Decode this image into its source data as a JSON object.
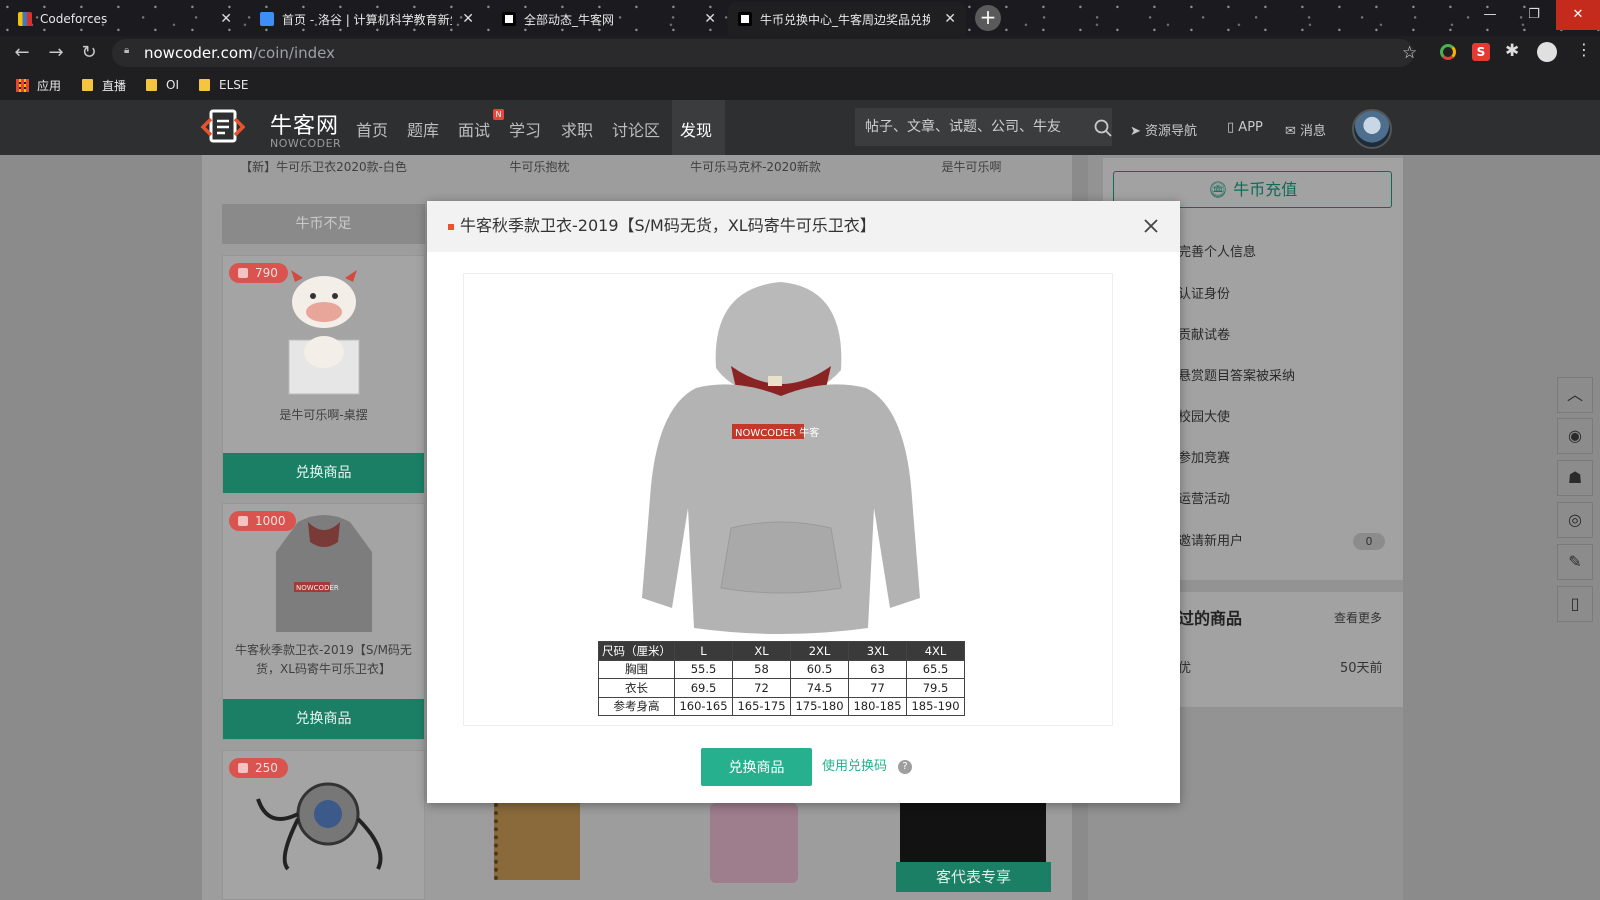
{
  "browser": {
    "tabs": [
      {
        "title": "Codeforces",
        "active": false
      },
      {
        "title": "首页 - 洛谷 | 计算机科学教育新生",
        "active": false
      },
      {
        "title": "全部动态_牛客网",
        "active": false
      },
      {
        "title": "牛币兑换中心_牛客周边奖品兑换",
        "active": true
      }
    ],
    "url_host": "nowcoder.com",
    "url_path": "/coin/index",
    "bookmarks": [
      {
        "label": "应用"
      },
      {
        "label": "直播"
      },
      {
        "label": "OI"
      },
      {
        "label": "ELSE"
      }
    ]
  },
  "site": {
    "logo_text": "牛客网",
    "logo_sub": "NOWCODER",
    "nav": [
      {
        "label": "首页"
      },
      {
        "label": "题库"
      },
      {
        "label": "面试"
      },
      {
        "label": "学习"
      },
      {
        "label": "求职"
      },
      {
        "label": "讨论区"
      },
      {
        "label": "发现"
      }
    ],
    "nav_active": "发现",
    "nav_badge": "N",
    "search_placeholder": "帖子、文章、试题、公司、牛友",
    "header_links": [
      {
        "label": "资源导航"
      },
      {
        "label": "APP"
      },
      {
        "label": "消息"
      }
    ]
  },
  "products": {
    "top_row_names": [
      "【新】牛可乐卫衣2020款-白色",
      "牛可乐抱枕",
      "牛可乐马克杯-2020新款",
      "是牛可乐啊"
    ],
    "insufficient_label": "牛币不足",
    "cards": [
      {
        "price": "790",
        "name": "是牛可乐啊-桌摆",
        "button": "兑换商品"
      },
      {
        "price": "1000",
        "name": "牛客秋季款卫衣-2019【S/M码无货，XL码寄牛可乐卫衣】",
        "button": "兑换商品"
      },
      {
        "price": "250",
        "name": "",
        "button": ""
      }
    ],
    "bottom_banner": "客代表专享"
  },
  "sidebar": {
    "recharge_label": "牛币充值",
    "tasks": [
      {
        "label": "完善个人信息"
      },
      {
        "label": "认证身份"
      },
      {
        "label": "贡献试卷"
      },
      {
        "label": "悬赏题目答案被采纳"
      },
      {
        "label": "校园大使"
      },
      {
        "label": "参加竞赛"
      },
      {
        "label": "运营活动"
      },
      {
        "label": "邀请新用户",
        "count": "0"
      }
    ],
    "exchanged_title": "过的商品",
    "view_more": "查看更多",
    "exchanged_item": {
      "name": "优",
      "time": "50天前"
    }
  },
  "modal": {
    "title": "牛客秋季款卫衣-2019【S/M码无货，XL码寄牛可乐卫衣】",
    "hoodie_print": "NOWCODER 牛客",
    "size_table": {
      "headers": [
        "尺码（厘米）",
        "L",
        "XL",
        "2XL",
        "3XL",
        "4XL"
      ],
      "rows": [
        {
          "label": "胸围",
          "values": [
            "55.5",
            "58",
            "60.5",
            "63",
            "65.5"
          ]
        },
        {
          "label": "衣长",
          "values": [
            "69.5",
            "72",
            "74.5",
            "77",
            "79.5"
          ]
        },
        {
          "label": "参考身高",
          "values": [
            "160-165",
            "165-175",
            "175-180",
            "180-185",
            "185-190"
          ]
        }
      ]
    },
    "redeem_button": "兑换商品",
    "code_link": "使用兑换码",
    "help_glyph": "?"
  },
  "colors": {
    "accent_green": "#26b08e",
    "price_red": "#d9534f",
    "header_bg": "#2e2f31"
  },
  "icons": [
    "back-arrow-icon",
    "forward-arrow-icon",
    "reload-icon",
    "lock-icon",
    "star-icon",
    "extensions-icon",
    "profile-icon",
    "search-icon",
    "send-icon",
    "phone-icon",
    "mail-icon",
    "close-icon",
    "coin-icon",
    "arrow-up-icon",
    "weibo-icon",
    "qq-icon",
    "wechat-icon",
    "pencil-icon",
    "mobile-icon"
  ]
}
